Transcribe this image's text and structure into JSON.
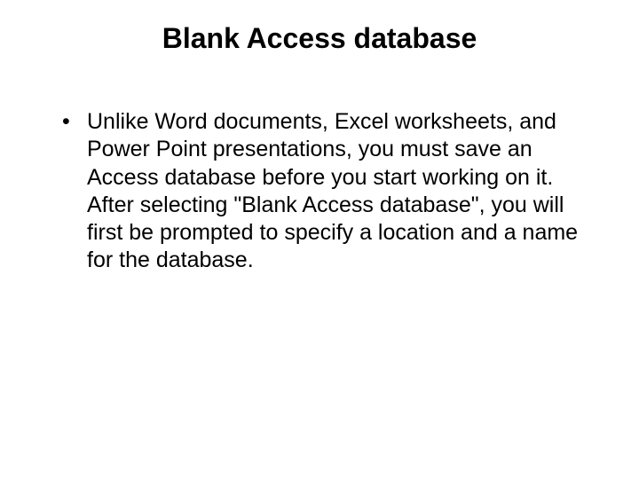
{
  "slide": {
    "title": "Blank Access database",
    "bullets": [
      "Unlike Word documents, Excel worksheets, and Power Point presentations, you must save an Access database before you start working on it. After selecting \"Blank Access database\", you will first be prompted to specify a location and a name for the database."
    ]
  }
}
